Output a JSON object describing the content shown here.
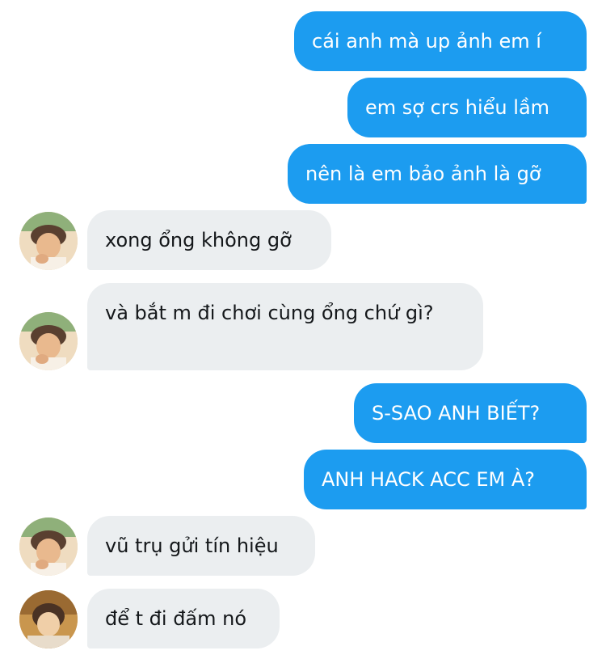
{
  "colors": {
    "outgoing_bubble": "#1c9cf0",
    "incoming_bubble": "#ebeef0",
    "outgoing_text": "#ffffff",
    "incoming_text": "#14171a"
  },
  "messages": [
    {
      "direction": "outgoing",
      "text": "cái anh mà up ảnh em í"
    },
    {
      "direction": "outgoing",
      "text": "em sợ crs hiểu lầm"
    },
    {
      "direction": "outgoing",
      "text": "nên là em bảo ảnh là gỡ"
    },
    {
      "direction": "incoming",
      "text": "xong ổng không gỡ",
      "avatar": "user-avatar"
    },
    {
      "direction": "incoming",
      "text": "và bắt m đi chơi cùng ổng chứ gì?",
      "avatar": "user-avatar"
    },
    {
      "direction": "outgoing",
      "text": "S-SAO ANH BIẾT?"
    },
    {
      "direction": "outgoing",
      "text": "ANH HACK ACC EM À?"
    },
    {
      "direction": "incoming",
      "text": "vũ trụ gửi tín hiệu",
      "avatar": "user-avatar"
    },
    {
      "direction": "incoming",
      "text": "để t đi đấm nó",
      "avatar": "user-avatar-2"
    }
  ]
}
